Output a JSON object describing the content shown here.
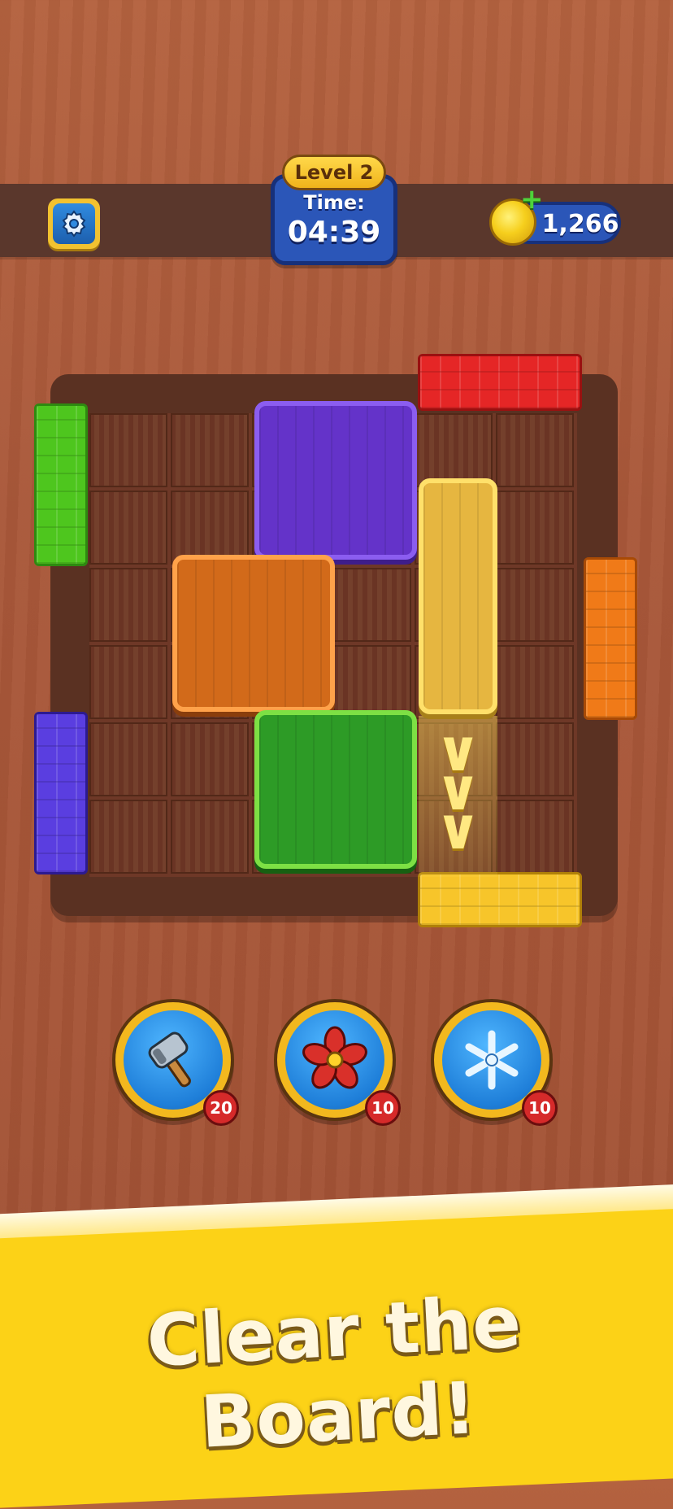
{
  "header": {
    "level_label": "Level 2",
    "time_label": "Time:",
    "time_value": "04:39",
    "coins": "1,266"
  },
  "icons": {
    "settings": "gear-icon",
    "coin": "coin-icon",
    "add_coins": "plus-icon"
  },
  "board": {
    "rows": 6,
    "cols": 6,
    "blocks": [
      {
        "color": "purple",
        "size": "2x2"
      },
      {
        "color": "orange",
        "size": "2x2"
      },
      {
        "color": "green",
        "size": "2x2"
      },
      {
        "color": "yellow",
        "size": "1x3"
      }
    ],
    "exits": [
      {
        "color": "green",
        "side": "left"
      },
      {
        "color": "purple",
        "side": "left"
      },
      {
        "color": "orange",
        "side": "right"
      },
      {
        "color": "red",
        "side": "top"
      },
      {
        "color": "yellow",
        "side": "bottom"
      }
    ],
    "colors": {
      "purple": "#6433c9",
      "orange": "#d26a1a",
      "green": "#2d9b26",
      "yellow": "#e6b640",
      "red": "#e52626"
    }
  },
  "boosters": [
    {
      "name": "hammer",
      "icon": "hammer-icon",
      "count": "20"
    },
    {
      "name": "fan",
      "icon": "fan-icon",
      "count": "10"
    },
    {
      "name": "freeze",
      "icon": "snowflake-icon",
      "count": "10"
    }
  ],
  "banner": {
    "headline": "Clear the Board!"
  }
}
